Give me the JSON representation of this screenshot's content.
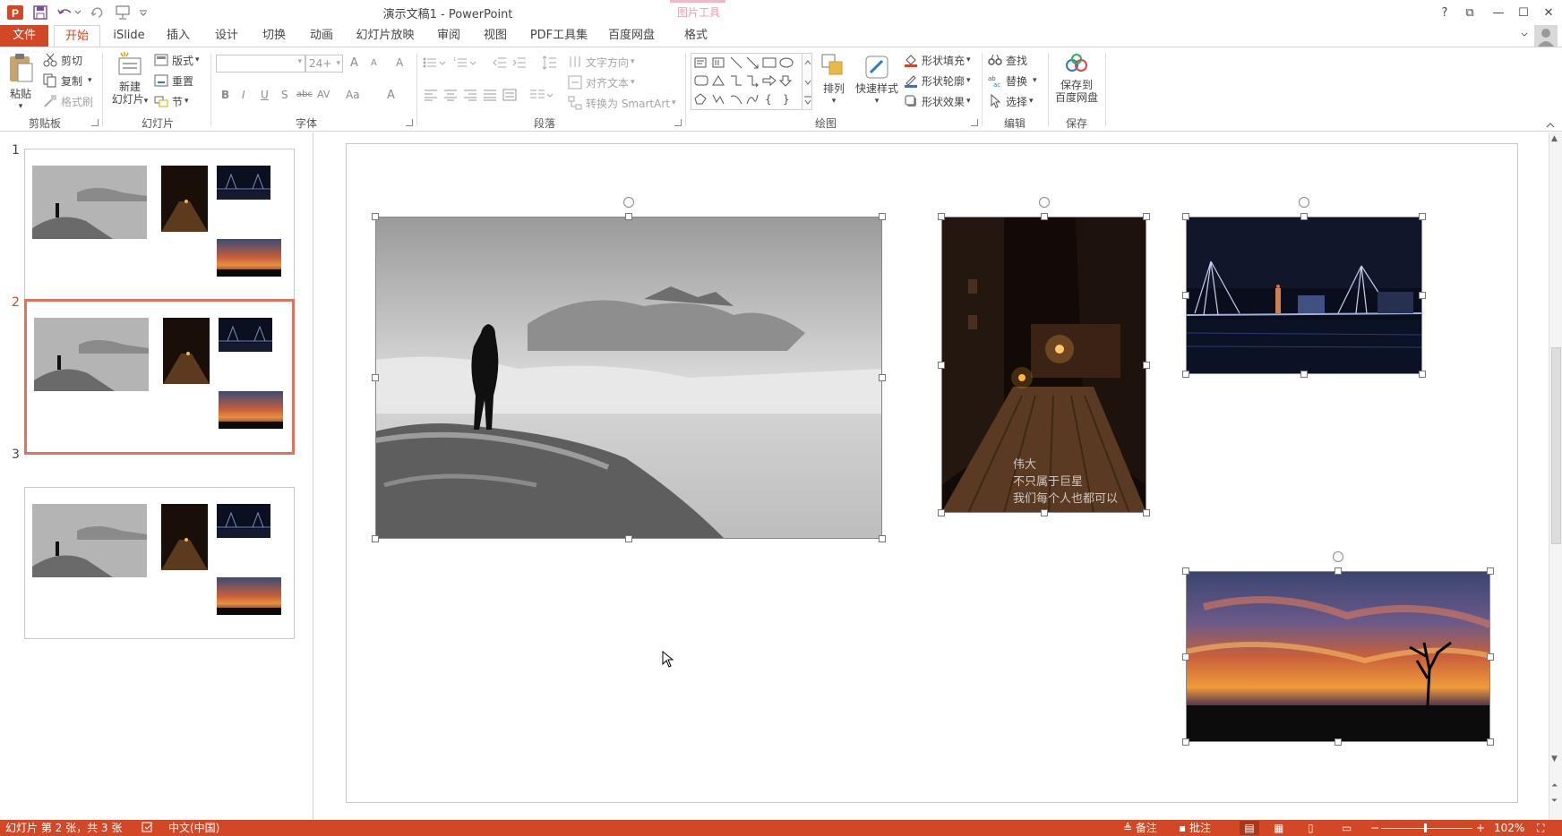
{
  "window": {
    "title": "演示文稿1 - PowerPoint",
    "context_tab_group": "图片工具",
    "help": "?",
    "ribbon_display": "⧉",
    "minimize": "—",
    "maximize": "☐",
    "close": "✕"
  },
  "tabs": [
    {
      "label": "文件",
      "active": false
    },
    {
      "label": "开始",
      "active": true
    },
    {
      "label": "iSlide",
      "active": false
    },
    {
      "label": "插入",
      "active": false
    },
    {
      "label": "设计",
      "active": false
    },
    {
      "label": "切换",
      "active": false
    },
    {
      "label": "动画",
      "active": false
    },
    {
      "label": "幻灯片放映",
      "active": false
    },
    {
      "label": "审阅",
      "active": false
    },
    {
      "label": "视图",
      "active": false
    },
    {
      "label": "PDF工具集",
      "active": false
    },
    {
      "label": "百度网盘",
      "active": false
    },
    {
      "label": "格式",
      "active": false
    }
  ],
  "ribbon": {
    "clipboard": {
      "paste": "粘贴",
      "cut": "剪切",
      "copy": "复制",
      "format_painter": "格式刷",
      "label": "剪贴板"
    },
    "slides": {
      "new_slide_line1": "新建",
      "new_slide_line2": "幻灯片",
      "layout": "版式",
      "reset": "重置",
      "section": "节",
      "label": "幻灯片"
    },
    "font": {
      "font_name": "",
      "font_size": "24+",
      "grow": "A",
      "shrink": "A",
      "clear": "A",
      "bold": "B",
      "italic": "I",
      "underline": "U",
      "shadow": "S",
      "strike": "abc",
      "spacing": "AV",
      "case": "Aa",
      "color": "A",
      "label": "字体"
    },
    "paragraph": {
      "text_direction": "文字方向",
      "align_text": "对齐文本",
      "smartart": "转换为 SmartArt",
      "label": "段落"
    },
    "drawing": {
      "arrange": "排列",
      "quick_styles": "快速样式",
      "shape_fill": "形状填充",
      "shape_outline": "形状轮廓",
      "shape_effects": "形状效果",
      "label": "绘图"
    },
    "editing": {
      "find": "查找",
      "replace": "替换",
      "select": "选择",
      "label": "编辑"
    },
    "save": {
      "line1": "保存到",
      "line2": "百度网盘",
      "label": "保存"
    }
  },
  "slides": [
    {
      "number": "1",
      "selected": false
    },
    {
      "number": "2",
      "selected": true
    },
    {
      "number": "3",
      "selected": false
    }
  ],
  "slide_content": {
    "street_caption": [
      "伟大",
      "不只属于巨星",
      "我们每个人也都可以"
    ]
  },
  "status": {
    "slide_info": "幻灯片 第 2 张，共 3 张",
    "language": "中文(中国)",
    "notes": "备注",
    "comments": "批注",
    "zoom": "102%"
  },
  "colors": {
    "accent": "#d24726",
    "thumb_selected": "#e0735a"
  }
}
